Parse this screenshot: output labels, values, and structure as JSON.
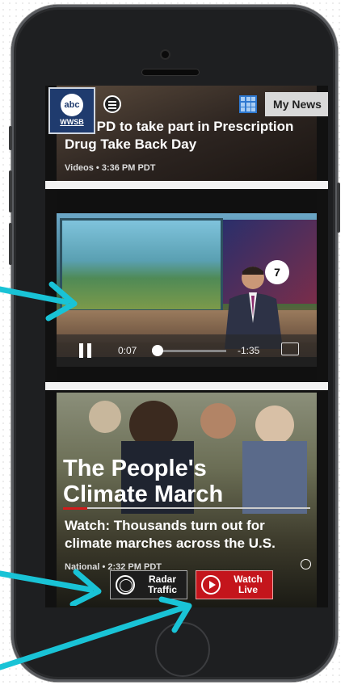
{
  "top_story": {
    "headline": "sota PD to take part in Prescription Drug Take Back Day",
    "meta": "Videos • 3:36 PM PDT"
  },
  "app_bar": {
    "station_abc": "abc",
    "station_call": "WWSB",
    "my_news": "My News"
  },
  "video_player": {
    "elapsed": "0:07",
    "remaining": "-1:35",
    "progress_fraction": 0.08
  },
  "climate_story": {
    "overlay_line1": "The People's",
    "overlay_line2": "Climate March",
    "headline": "Watch: Thousands turn out for climate marches across the U.S.",
    "meta": "National • 2:32 PM PDT"
  },
  "floating_buttons": {
    "radar_line1": "Radar",
    "radar_line2": "Traffic",
    "watch_line1": "Watch",
    "watch_line2": "Live"
  },
  "colors": {
    "annotation_arrow": "#19c3d6",
    "watch_live": "#c4151c",
    "grid_icon": "#2e78d0"
  }
}
